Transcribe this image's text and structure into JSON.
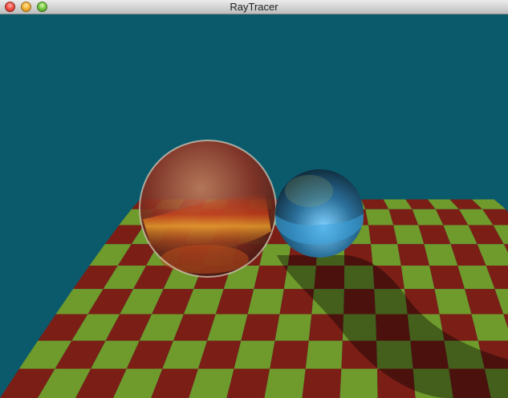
{
  "window": {
    "title": "RayTracer"
  },
  "scene": {
    "background_color": "#0b5a6b",
    "floor_colors": [
      "#7a1e16",
      "#6f9a2c"
    ],
    "sphere_left_color": "#a23b22",
    "sphere_right_color": "#1f5f8a"
  }
}
